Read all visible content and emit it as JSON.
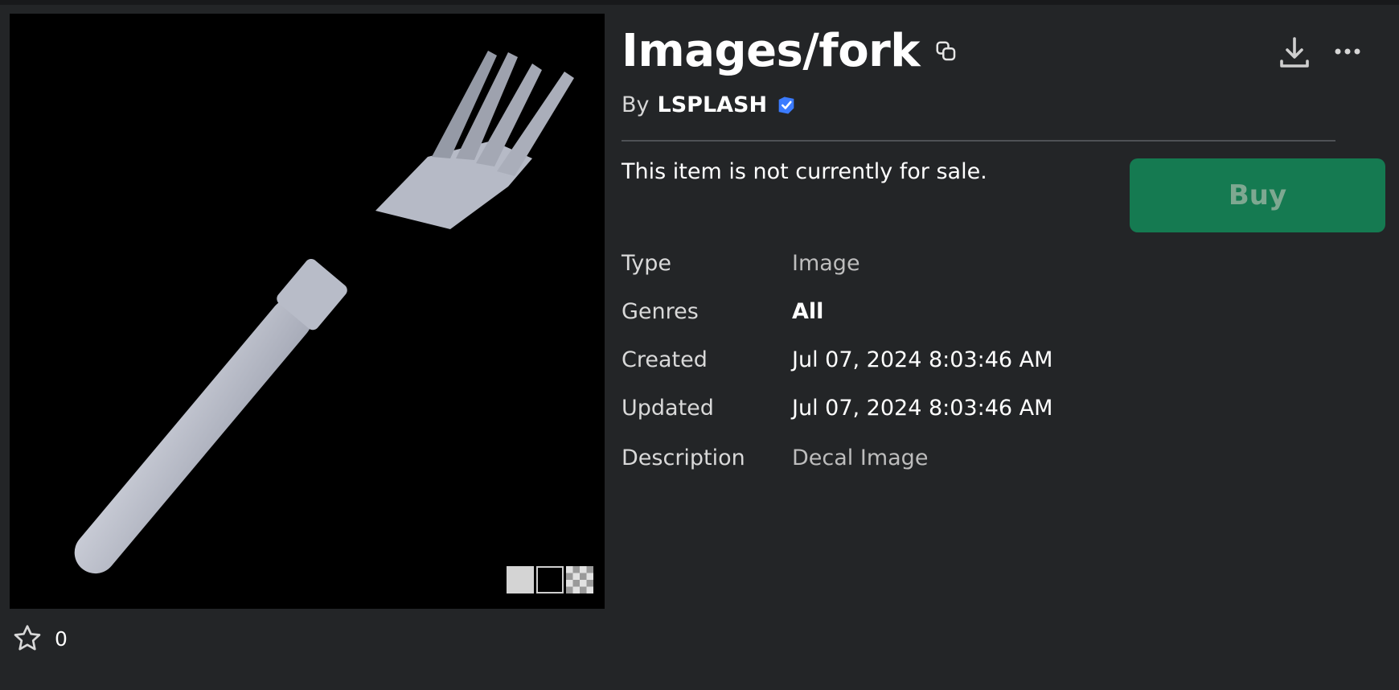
{
  "item": {
    "title": "Images/fork",
    "by_label": "By",
    "creator": "LSPLASH",
    "sale_status": "This item is not currently for sale.",
    "buy_label": "Buy",
    "favorites_count": "0"
  },
  "details": {
    "type_label": "Type",
    "type_value": "Image",
    "genres_label": "Genres",
    "genres_value": "All",
    "created_label": "Created",
    "created_value": "Jul 07, 2024 8:03:46 AM",
    "updated_label": "Updated",
    "updated_value": "Jul 07, 2024 8:03:46 AM",
    "description_label": "Description",
    "description_value": "Decal Image"
  },
  "icons": [
    "copy-icon",
    "download-icon",
    "more-icon",
    "verified-icon",
    "star-icon"
  ],
  "colors": {
    "background": "#232527",
    "buy_button": "#157a51",
    "verified": "#3b7bff"
  }
}
